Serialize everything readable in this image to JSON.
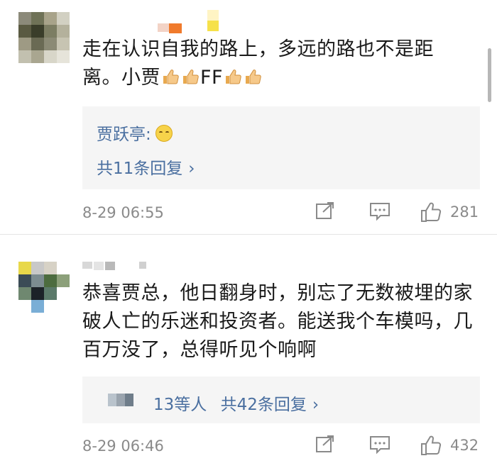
{
  "comments": [
    {
      "text_line1": "走在认识自我的路上，多远的路也不是距",
      "text_line2_prefix": "离。小贾",
      "text_line2_mid": "FF",
      "reply": {
        "author": "贾跃亭:",
        "count_label": "共11条回复"
      },
      "timestamp": "8-29 06:55",
      "likes": "281"
    },
    {
      "text": "恭喜贾总，他日翻身时，别忘了无数被埋的家破人亡的乐迷和投资者。能送我个车模吗，几百万没了，总得听见个响啊",
      "reply": {
        "likers_label": "13等人",
        "count_label": "共42条回复"
      },
      "timestamp": "8-29 06:46",
      "likes": "432"
    }
  ],
  "icons": {
    "share": "share-icon",
    "comment": "comment-icon",
    "like": "thumbs-up-icon",
    "emoji_thumb": "thumbs-up-emoji-icon",
    "emoji_smile": "smile-emoji-icon",
    "chevron": "chevron-right-icon"
  },
  "colors": {
    "link": "#4a6fa0",
    "meta": "#8a8a8a",
    "reply_bg": "#f5f5f5"
  },
  "arrow_glyph": "›"
}
